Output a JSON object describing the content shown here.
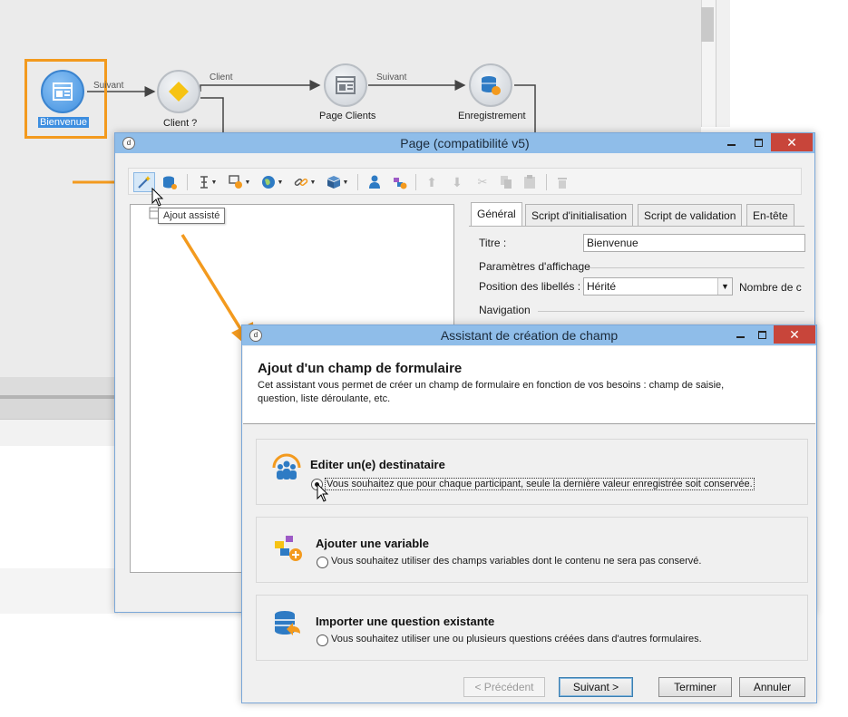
{
  "workflow": {
    "nodes": [
      {
        "label": "Bienvenue",
        "icon": "page-icon",
        "selected": true
      },
      {
        "label": "Client ?",
        "icon": "test-diamond-icon"
      },
      {
        "label": "Page Clients",
        "icon": "page-icon"
      },
      {
        "label": "Enregistrement",
        "icon": "database-save-icon"
      }
    ],
    "links": [
      "Suivant",
      "Client",
      "Suivant"
    ]
  },
  "page_window": {
    "title": "Page (compatibilité v5)",
    "tooltip": "Ajout assisté",
    "tabs": [
      "Général",
      "Script d'initialisation",
      "Script de validation",
      "En-tête"
    ],
    "active_tab": "Général",
    "titre_label": "Titre :",
    "titre_value": "Bienvenue",
    "display_section": "Paramètres d'affichage",
    "labels_position_label": "Position des libellés :",
    "labels_position_value": "Hérité",
    "columns_label": "Nombre de c",
    "navigation_section": "Navigation"
  },
  "assistant": {
    "title": "Assistant de création de champ",
    "heading": "Ajout d'un champ de formulaire",
    "description_line1": "Cet assistant vous permet de créer un champ de formulaire en fonction de vos besoins : champ de saisie,",
    "description_line2": "question, liste déroulante, etc.",
    "options": [
      {
        "title": "Editer un(e) destinataire",
        "text": "Vous souhaitez que pour chaque participant, seule la dernière valeur enregistrée soit conservée.",
        "checked": true,
        "icon": "recipients-icon"
      },
      {
        "title": "Ajouter une variable",
        "text": "Vous souhaitez utiliser des champs variables dont le contenu ne sera pas conservé.",
        "checked": false,
        "icon": "add-variable-icon"
      },
      {
        "title": "Importer une question existante",
        "text": "Vous souhaitez utiliser une ou plusieurs questions créées dans d'autres formulaires.",
        "checked": false,
        "icon": "import-question-icon"
      }
    ],
    "buttons": {
      "previous": "< Précédent",
      "next": "Suivant >",
      "finish": "Terminer",
      "cancel": "Annuler"
    }
  },
  "colors": {
    "highlight_orange": "#f39a1e",
    "titlebar_blue": "#8fbde9",
    "close_red": "#c8453a",
    "selection_blue": "#3d8ee0"
  }
}
